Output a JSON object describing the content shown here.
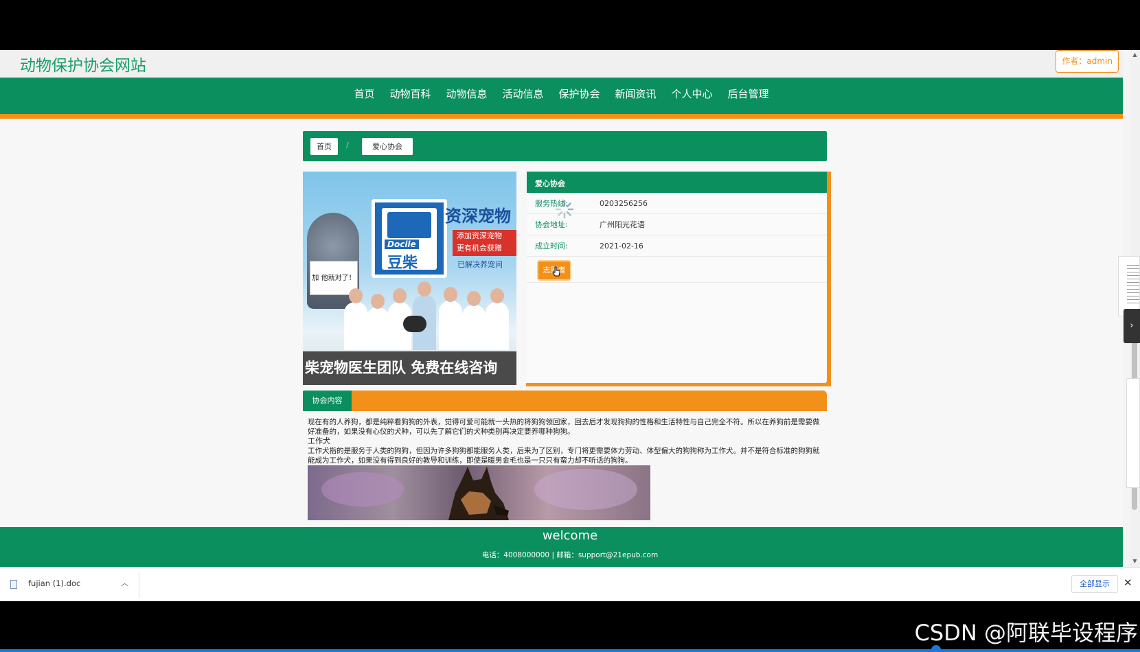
{
  "site": {
    "title": "动物保护协会网站",
    "author": "作者：admin"
  },
  "nav": {
    "items": [
      "首页",
      "动物百科",
      "动物信息",
      "活动信息",
      "保护协会",
      "新闻资讯",
      "个人中心",
      "后台管理"
    ]
  },
  "breadcrumb": {
    "home": "首页",
    "separator": "/",
    "current": "爱心协会"
  },
  "banner": {
    "logo_text": "资深宠物",
    "promo_line1": "添加资深宠物",
    "promo_line2": "更有机会获赠",
    "sub_text": "已解决养宠问",
    "brand_en": "Docile",
    "brand_cn": "豆柴",
    "sign_text": "加 他就对了！",
    "bottom_text": "柴宠物医生团队  免费在线咨询"
  },
  "info": {
    "header": "爱心协会",
    "rows": [
      {
        "label": "服务热线:",
        "value": "0203256256"
      },
      {
        "label": "协会地址:",
        "value": "广州阳光花语"
      },
      {
        "label": "成立时间:",
        "value": "2021-02-16"
      }
    ],
    "volunteer_label": "志愿者"
  },
  "content": {
    "tab": "协会内容",
    "para1": "现在有的人养狗，都是纯粹看狗狗的外表，觉得可爱可能就一头热的将狗狗领回家，回去后才发现狗狗的性格和生活特性与自己完全不符。所以在养狗前是需要做好准备的，如果没有心仪的犬种，可以先了解它们的犬种类别再决定要养哪种狗狗。",
    "heading": "工作犬",
    "para2": "工作犬指的是服务于人类的狗狗，但因为许多狗狗都能服务人类，后来为了区别，专门将更需要体力劳动、体型偏大的狗狗称为工作犬。并不是符合标准的狗狗就能成为工作犬，如果没有得到良好的教导和训练，即使是暖男金毛也是一只只有蛮力却不听话的狗狗。"
  },
  "footer": {
    "title": "welcome",
    "contact": "电话：4008000000 | 邮箱：support@21epub.com"
  },
  "download_bar": {
    "file_name": "fujian (1).doc",
    "show_all": "全部显示"
  },
  "watermark": "CSDN @阿联毕设程序",
  "colors": {
    "primary_green": "#0b8f5f",
    "accent_orange": "#f39019"
  }
}
